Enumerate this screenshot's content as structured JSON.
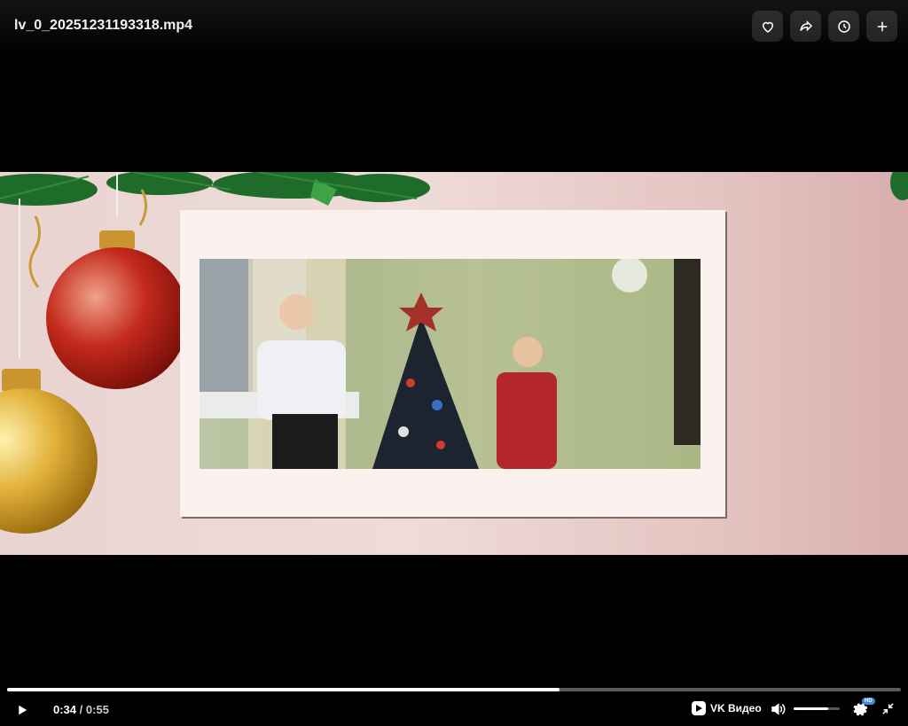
{
  "header": {
    "title": "lv_0_20251231193318.mp4",
    "actions": [
      {
        "name": "like",
        "icon": "heart-icon"
      },
      {
        "name": "share",
        "icon": "share-icon"
      },
      {
        "name": "watch-later",
        "icon": "clock-icon"
      },
      {
        "name": "add",
        "icon": "plus-icon"
      }
    ]
  },
  "player": {
    "current_time": "0:34",
    "separator": "/",
    "duration": "0:55",
    "progress_fraction": 0.618,
    "volume_fraction": 0.75,
    "brand_label": "VK Видео",
    "quality_badge": "HD",
    "accent_color": "#3f8ae0"
  }
}
